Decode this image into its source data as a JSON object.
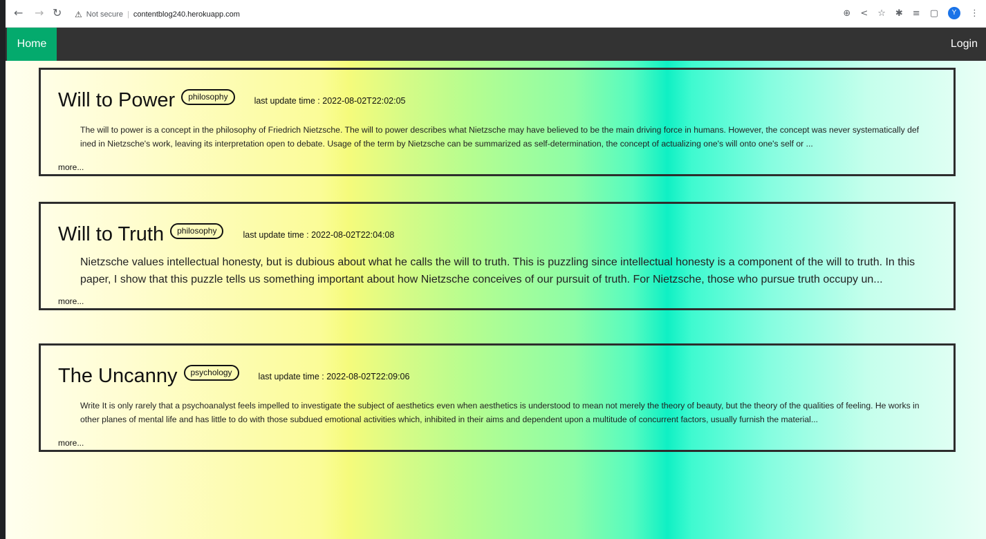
{
  "browser": {
    "security_label": "Not secure",
    "url": "contentblog240.herokuapp.com",
    "profile_initial": "Y"
  },
  "nav": {
    "home_label": "Home",
    "login_label": "Login"
  },
  "posts": [
    {
      "title": "Will to Power",
      "tag": "philosophy",
      "updated_label": "last update time : 2022-08-02T22:02:05",
      "excerpt": "The will to power is a concept in the philosophy of Friedrich Nietzsche. The will to power describes what Nietzsche may have believed to be the main driving force in humans. However, the concept was never systematically defined in Nietzsche's work, leaving its interpretation open to debate. Usage of the term by Nietzsche can be summarized as self-determination, the concept of actualizing one's will onto one's self or ...",
      "more_label": "more..."
    },
    {
      "title": "Will to Truth",
      "tag": "philosophy",
      "updated_label": "last update time : 2022-08-02T22:04:08",
      "excerpt": "Nietzsche values intellectual honesty, but is dubious about what he calls the will to truth. This is puzzling since intellectual honesty is a component of the will to truth. In this paper, I show that this puzzle tells us something important about how Nietzsche conceives of our pursuit of truth. For Nietzsche, those who pursue truth occupy un...",
      "more_label": "more..."
    },
    {
      "title": "The Uncanny",
      "tag": "psychology",
      "updated_label": "last update time : 2022-08-02T22:09:06",
      "excerpt": "Write It is only rarely that a psychoanalyst feels impelled to investigate the subject of aesthetics even when aesthetics is understood to mean not merely the theory of beauty, but the theory of the qualities of feeling. He works in other planes of mental life and has little to do with those subdued emotional activities which, inhibited in their aims and dependent upon a multitude of concurrent factors, usually furnish the material...",
      "more_label": "more..."
    }
  ]
}
